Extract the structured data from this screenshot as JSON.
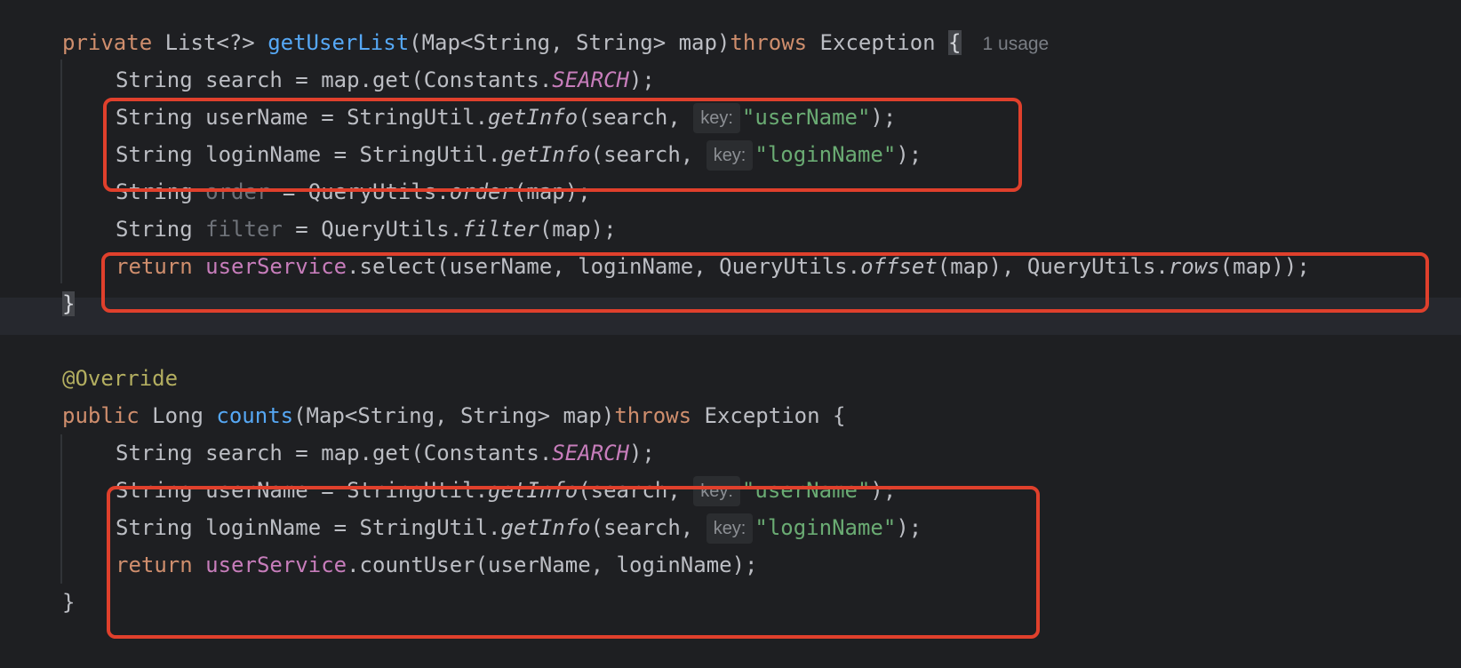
{
  "editor": {
    "highlight_color": "#e0402c",
    "code": {
      "l1": {
        "mod": "private",
        "ret": " List<?> ",
        "name": "getUserList",
        "params": "(Map<String, String> map)",
        "throws": "throws",
        "exc": " Exception ",
        "brace": "{",
        "usage": "1 usage"
      },
      "l2": {
        "a": "String search = map.get(Constants.",
        "const": "SEARCH",
        "b": ");"
      },
      "l3": {
        "a": "String userName = StringUtil.",
        "method": "getInfo",
        "b": "(search, ",
        "hint": "key:",
        "str": "\"userName\"",
        "c": ");"
      },
      "l4": {
        "a": "String loginName = StringUtil.",
        "method": "getInfo",
        "b": "(search, ",
        "hint": "key:",
        "str": "\"loginName\"",
        "c": ");"
      },
      "l5": {
        "a": "String ",
        "var": "order",
        "b": " = QueryUtils.",
        "method": "order",
        "c": "(map);"
      },
      "l6": {
        "a": "String ",
        "var": "filter",
        "b": " = QueryUtils.",
        "method": "filter",
        "c": "(map);"
      },
      "l7": {
        "kw": "return",
        "field": "userService",
        "a": ".select(userName, loginName, QueryUtils.",
        "m1": "offset",
        "b": "(map), QueryUtils.",
        "m2": "rows",
        "c": "(map));"
      },
      "l8": {
        "brace": "}"
      },
      "l9": {
        "ann": "@Override"
      },
      "l10": {
        "mod": "public",
        "ret": " Long ",
        "name": "counts",
        "params": "(Map<String, String> map)",
        "throws": "throws",
        "exc": " Exception {"
      },
      "l11": {
        "a": "String search = map.get(Constants.",
        "const": "SEARCH",
        "b": ");"
      },
      "l12": {
        "a": "String userName = StringUtil.",
        "method": "getInfo",
        "b": "(search, ",
        "hint": "key:",
        "str": "\"userName\"",
        "c": ");"
      },
      "l13": {
        "a": "String loginName = StringUtil.",
        "method": "getInfo",
        "b": "(search, ",
        "hint": "key:",
        "str": "\"loginName\"",
        "c": ");"
      },
      "l14": {
        "kw": "return",
        "field": "userService",
        "a": ".countUser(userName, loginName);"
      },
      "l15": {
        "brace": "}"
      }
    }
  }
}
